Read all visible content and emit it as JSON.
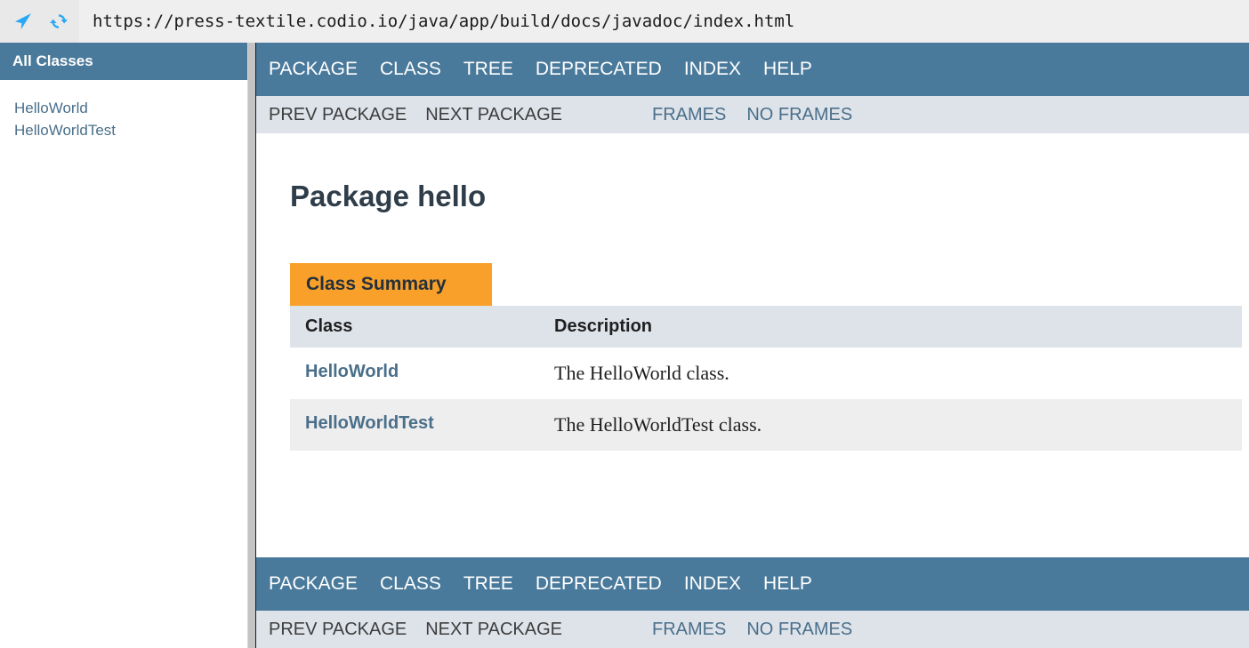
{
  "browser": {
    "url": "https://press-textile.codio.io/java/app/build/docs/javadoc/index.html",
    "url_placeholder": "Enter address",
    "icons": {
      "navigate": "navigate-arrow-icon",
      "reload": "reload-icon"
    },
    "accent_color": "#29a8f5"
  },
  "sidebar": {
    "title": "All Classes",
    "items": [
      {
        "label": "HelloWorld"
      },
      {
        "label": "HelloWorldTest"
      }
    ]
  },
  "navbar": {
    "items": [
      {
        "label": "PACKAGE"
      },
      {
        "label": "CLASS"
      },
      {
        "label": "TREE"
      },
      {
        "label": "DEPRECATED"
      },
      {
        "label": "INDEX"
      },
      {
        "label": "HELP"
      }
    ]
  },
  "subnav": {
    "prev": "PREV PACKAGE",
    "next": "NEXT PACKAGE",
    "frames": "FRAMES",
    "no_frames": "NO FRAMES"
  },
  "main": {
    "page_title": "Package hello",
    "summary": {
      "tab_label": "Class Summary",
      "columns": {
        "class": "Class",
        "description": "Description"
      },
      "rows": [
        {
          "class": "HelloWorld",
          "description": "The HelloWorld class."
        },
        {
          "class": "HelloWorldTest",
          "description": "The HelloWorldTest class."
        }
      ]
    }
  },
  "colors": {
    "nav_blue": "#4a7a9b",
    "subnav_bg": "#dee3ea",
    "link_blue": "#4a6f8a",
    "tab_orange": "#f8a02a",
    "row_alt": "#eeeeee"
  }
}
